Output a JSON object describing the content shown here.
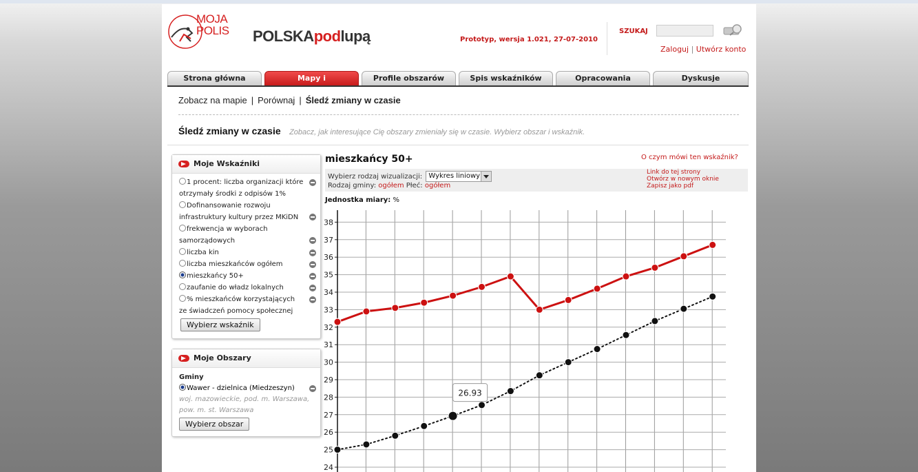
{
  "header": {
    "logo_line1": "MOJA",
    "logo_line2": "POLIS",
    "brand_part1": "POLSKA",
    "brand_part2": "pod",
    "brand_part3": "lupą",
    "version": "Prototyp, wersja 1.021, 27-07-2010",
    "search_label": "SZUKAJ",
    "search_placeholder": "",
    "login": "Zaloguj",
    "register": "Utwórz konto",
    "login_sep": "|"
  },
  "tabs": [
    {
      "label": "Strona główna"
    },
    {
      "label": "Mapy i"
    },
    {
      "label": "Profile obszarów"
    },
    {
      "label": "Spis wskaźników"
    },
    {
      "label": "Opracowania"
    },
    {
      "label": "Dyskusje"
    }
  ],
  "subnav": {
    "items": [
      "Zobacz na mapie",
      "Porównaj",
      "Śledź zmiany w czasie"
    ],
    "sep": "|"
  },
  "page": {
    "heading": "Śledź zmiany w czasie",
    "description": "Zobacz, jak interesujące Cię obszary zmieniały się w czasie. Wybierz obszar i wskaźnik."
  },
  "indicators_panel": {
    "title": "Moje Wskaźniki",
    "items": [
      {
        "label": "1 procent: liczba organizacji które otrzymały środki z odpisów 1%",
        "selected": false
      },
      {
        "label": "Dofinansowanie rozwoju infrastruktury kultury przez MKiDN",
        "selected": false
      },
      {
        "label": "frekwencja w wyborach samorządowych",
        "selected": false
      },
      {
        "label": "liczba kin",
        "selected": false
      },
      {
        "label": "liczba mieszkańców ogółem",
        "selected": false
      },
      {
        "label": "mieszkańcy 50+",
        "selected": true
      },
      {
        "label": "zaufanie do władz lokalnych",
        "selected": false
      },
      {
        "label": "% mieszkańców korzystających ze świadczeń pomocy społecznej",
        "selected": false
      }
    ],
    "button": "Wybierz wskaźnik"
  },
  "areas_panel": {
    "title": "Moje Obszary",
    "group": "Gminy",
    "area": "Wawer - dzielnica (Miedzeszyn)",
    "area_sub": "woj. mazowieckie, pod. m. Warszawa, pow. m. st. Warszawa",
    "button": "Wybierz obszar"
  },
  "main": {
    "title": "mieszkańcy 50+",
    "about_link": "O czym mówi ten wskaźnik?",
    "viz_label": "Wybierz rodzaj wizualizacji:",
    "viz_value": "Wykres liniowy",
    "gmina_label": "Rodzaj gminy:",
    "gmina_value": "ogółem",
    "sex_label": "Płeć:",
    "sex_value": "ogółem",
    "link_here": "Link do tej strony",
    "open_new": "Otwórz w nowym oknie",
    "save_pdf": "Zapisz jako pdf",
    "unit_label": "Jednostka miary:",
    "unit_value": "%",
    "tooltip": "26.93"
  },
  "colors": {
    "accent": "#d62020",
    "series_red": "#cc1111",
    "series_black": "#111111"
  },
  "chart_data": {
    "type": "line",
    "ylim": [
      24,
      38
    ],
    "y_ticks": [
      24,
      25,
      26,
      27,
      28,
      29,
      30,
      31,
      32,
      33,
      34,
      35,
      36,
      37,
      38
    ],
    "grid": true,
    "series": [
      {
        "style": "solid",
        "values": [
          32.3,
          32.9,
          33.1,
          33.4,
          33.8,
          34.3,
          34.9,
          33.0,
          33.55,
          34.2,
          34.9,
          35.4,
          36.05,
          36.7
        ]
      },
      {
        "style": "dotted",
        "values": [
          25.0,
          25.3,
          25.8,
          26.35,
          26.93,
          27.55,
          28.35,
          29.25,
          30.0,
          30.75,
          31.55,
          32.35,
          33.05,
          33.75
        ]
      }
    ]
  }
}
